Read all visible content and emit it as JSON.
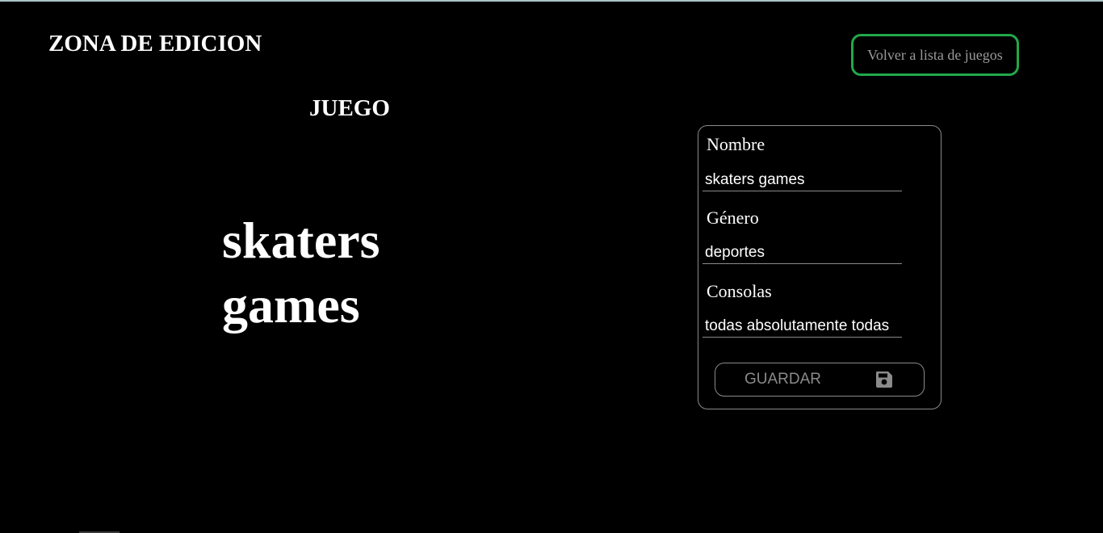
{
  "header": {
    "title": "ZONA DE EDICION",
    "back_button_label": "Volver a lista de juegos"
  },
  "game_panel": {
    "section_title": "JUEGO",
    "game_name": "skaters games"
  },
  "form": {
    "fields": [
      {
        "label": "Nombre",
        "value": "skaters games"
      },
      {
        "label": "Género",
        "value": "deportes"
      },
      {
        "label": "Consolas",
        "value": "todas absolutamente todas"
      }
    ],
    "save_button_label": "GUARDAR",
    "save_icon": "floppy-disk-icon"
  },
  "colors": {
    "background": "#000000",
    "text": "#ffffff",
    "accent_border": "#22a84a",
    "muted": "#8a8a8a"
  }
}
